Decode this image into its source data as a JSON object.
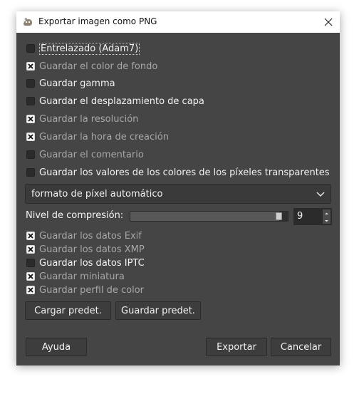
{
  "dialog": {
    "title": "Exportar imagen como PNG",
    "checkboxes": [
      {
        "label": "Entrelazado (Adam7)",
        "checked": false,
        "enabled": true
      },
      {
        "label": "Guardar el color de fondo",
        "checked": true,
        "enabled": false
      },
      {
        "label": "Guardar gamma",
        "checked": false,
        "enabled": true
      },
      {
        "label": "Guardar el desplazamiento de capa",
        "checked": false,
        "enabled": true
      },
      {
        "label": "Guardar la resolución",
        "checked": true,
        "enabled": false
      },
      {
        "label": "Guardar la hora de creación",
        "checked": true,
        "enabled": false
      },
      {
        "label": "Guardar el comentario",
        "checked": false,
        "enabled": false
      },
      {
        "label": "Guardar los valores de los colores de los píxeles transparentes",
        "checked": false,
        "enabled": true
      }
    ],
    "pixel_format": "formato de píxel automático",
    "compression": {
      "label": "Nivel de compresión:",
      "value": "9",
      "level": 0.96
    },
    "metadata": [
      {
        "label": "Guardar los datos Exif",
        "checked": true,
        "enabled": false
      },
      {
        "label": "Guardar los datos XMP",
        "checked": true,
        "enabled": false
      },
      {
        "label": "Guardar los datos IPTC",
        "checked": false,
        "enabled": true
      },
      {
        "label": "Guardar miniatura",
        "checked": true,
        "enabled": false
      },
      {
        "label": "Guardar perfil de color",
        "checked": true,
        "enabled": false
      }
    ],
    "buttons": {
      "load_defaults": "Cargar predet.",
      "save_defaults": "Guardar predet.",
      "help": "Ayuda",
      "export": "Exportar",
      "cancel": "Cancelar"
    }
  }
}
